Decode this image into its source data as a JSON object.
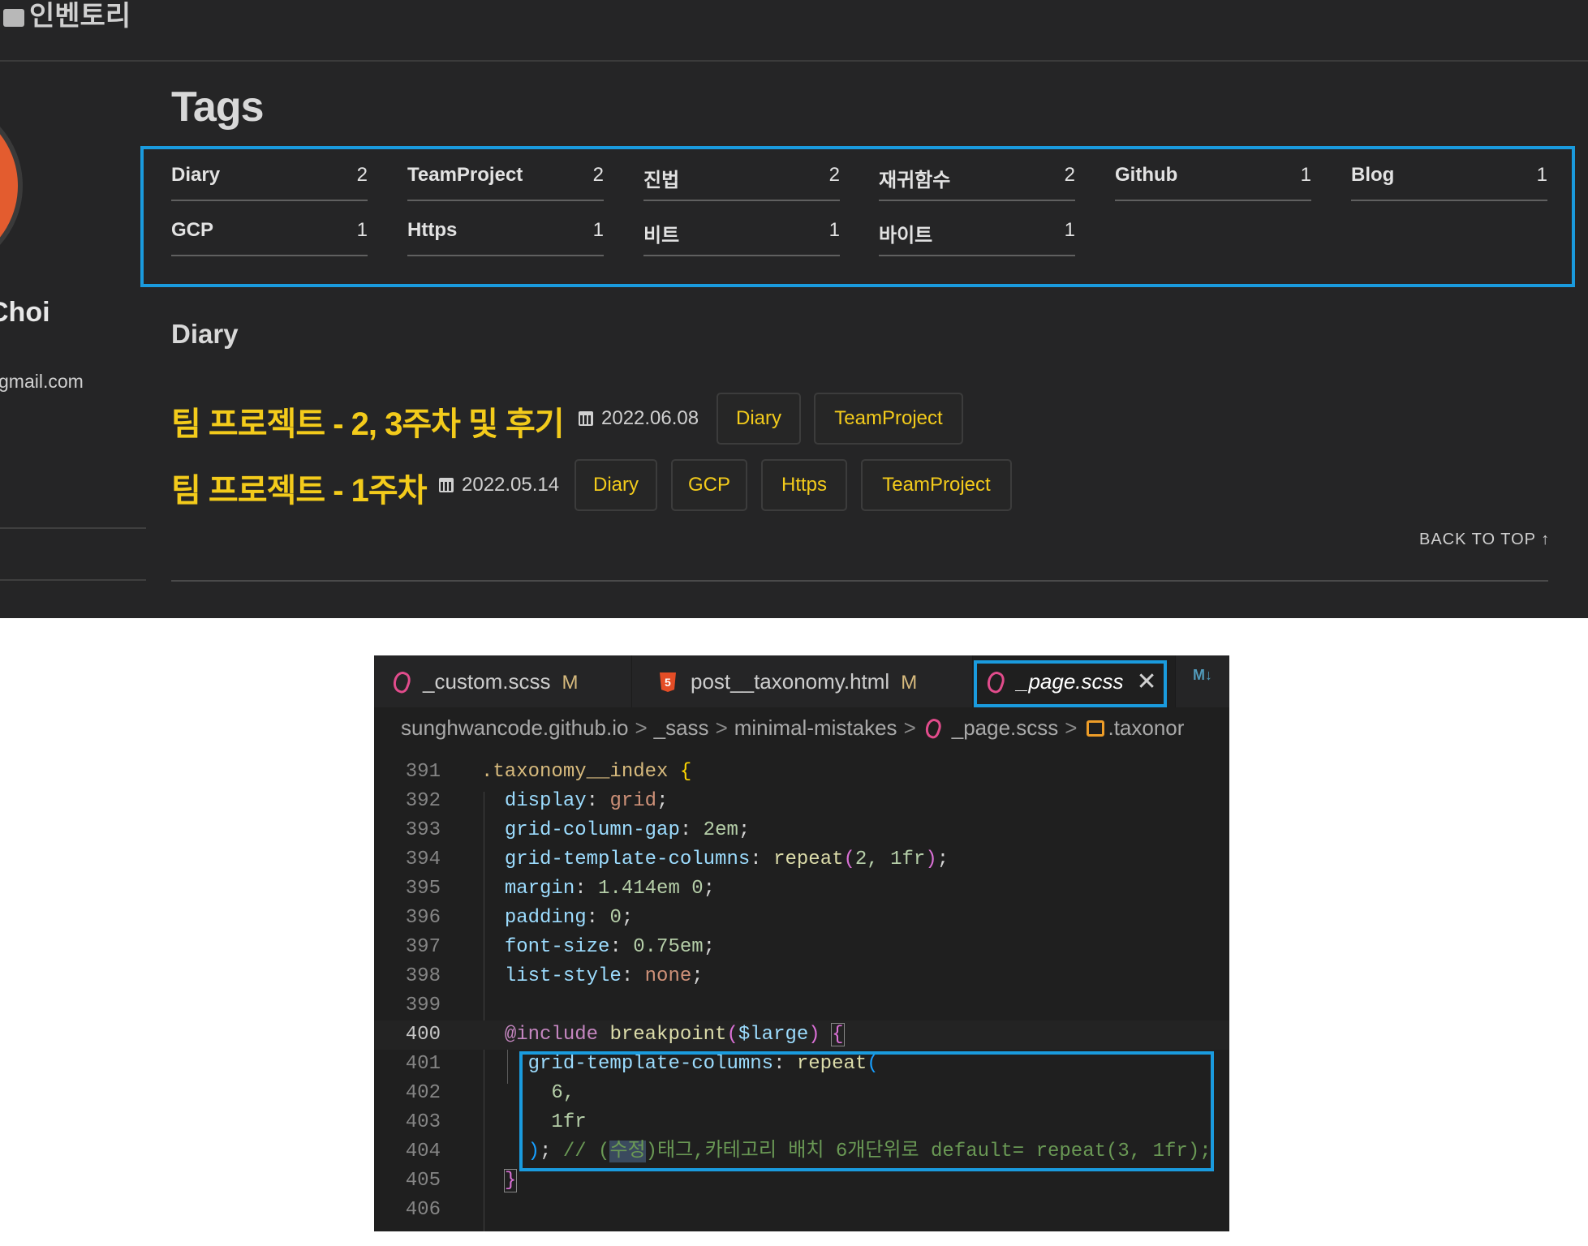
{
  "blog": {
    "nav_title": "인벤토리",
    "author_name": "Choi",
    "author_email": "gmail.com",
    "page_title": "Tags",
    "tags": [
      {
        "name": "Diary",
        "count": "2"
      },
      {
        "name": "TeamProject",
        "count": "2"
      },
      {
        "name": "진법",
        "count": "2"
      },
      {
        "name": "재귀함수",
        "count": "2"
      },
      {
        "name": "Github",
        "count": "1"
      },
      {
        "name": "Blog",
        "count": "1"
      },
      {
        "name": "GCP",
        "count": "1"
      },
      {
        "name": "Https",
        "count": "1"
      },
      {
        "name": "비트",
        "count": "1"
      },
      {
        "name": "바이트",
        "count": "1"
      }
    ],
    "section_title": "Diary",
    "posts": [
      {
        "title": "팀 프로젝트 - 2, 3주차 및 후기",
        "date": "2022.06.08",
        "tags": [
          "Diary",
          "TeamProject"
        ]
      },
      {
        "title": "팀 프로젝트 - 1주차",
        "date": "2022.05.14",
        "tags": [
          "Diary",
          "GCP",
          "Https",
          "TeamProject"
        ]
      }
    ],
    "back_to_top": "BACK TO TOP ↑"
  },
  "editor": {
    "tabs": [
      {
        "label": "_custom.scss",
        "modified": "M",
        "icon": "sass-icon"
      },
      {
        "label": "post__taxonomy.html",
        "modified": "M",
        "icon": "html5-icon"
      },
      {
        "label": "_page.scss",
        "modified": "",
        "icon": "sass-icon",
        "close": "✕"
      }
    ],
    "overflow_tab_icon": "M↓",
    "breadcrumbs": [
      "sunghwancode.github.io",
      "_sass",
      "minimal-mistakes",
      "_page.scss",
      ".taxonor"
    ],
    "current_line": "400",
    "line_numbers": [
      "391",
      "392",
      "393",
      "394",
      "395",
      "396",
      "397",
      "398",
      "399",
      "400",
      "401",
      "402",
      "403",
      "404",
      "405",
      "406"
    ],
    "code": {
      "l391": ".taxonomy__index",
      "l392p": "display",
      "l392v": "grid",
      "l393p": "grid-column-gap",
      "l393v": "2em",
      "l394p": "grid-template-columns",
      "l394f": "repeat",
      "l394a": "2, 1fr",
      "l395p": "margin",
      "l395v": "1.414em 0",
      "l396p": "padding",
      "l396v": "0",
      "l397p": "font-size",
      "l397v": "0.75em",
      "l398p": "list-style",
      "l398v": "none",
      "l400at": "@include",
      "l400f": "breakpoint",
      "l400a": "$large",
      "l401p": "grid-template-columns",
      "l401f": "repeat",
      "l402": "6,",
      "l403": "1fr",
      "l404c1": "// (",
      "l404c2": "수정",
      "l404c3": ")태그,카테고리 배치 6개단위로 default= repeat(3, 1fr);"
    }
  }
}
